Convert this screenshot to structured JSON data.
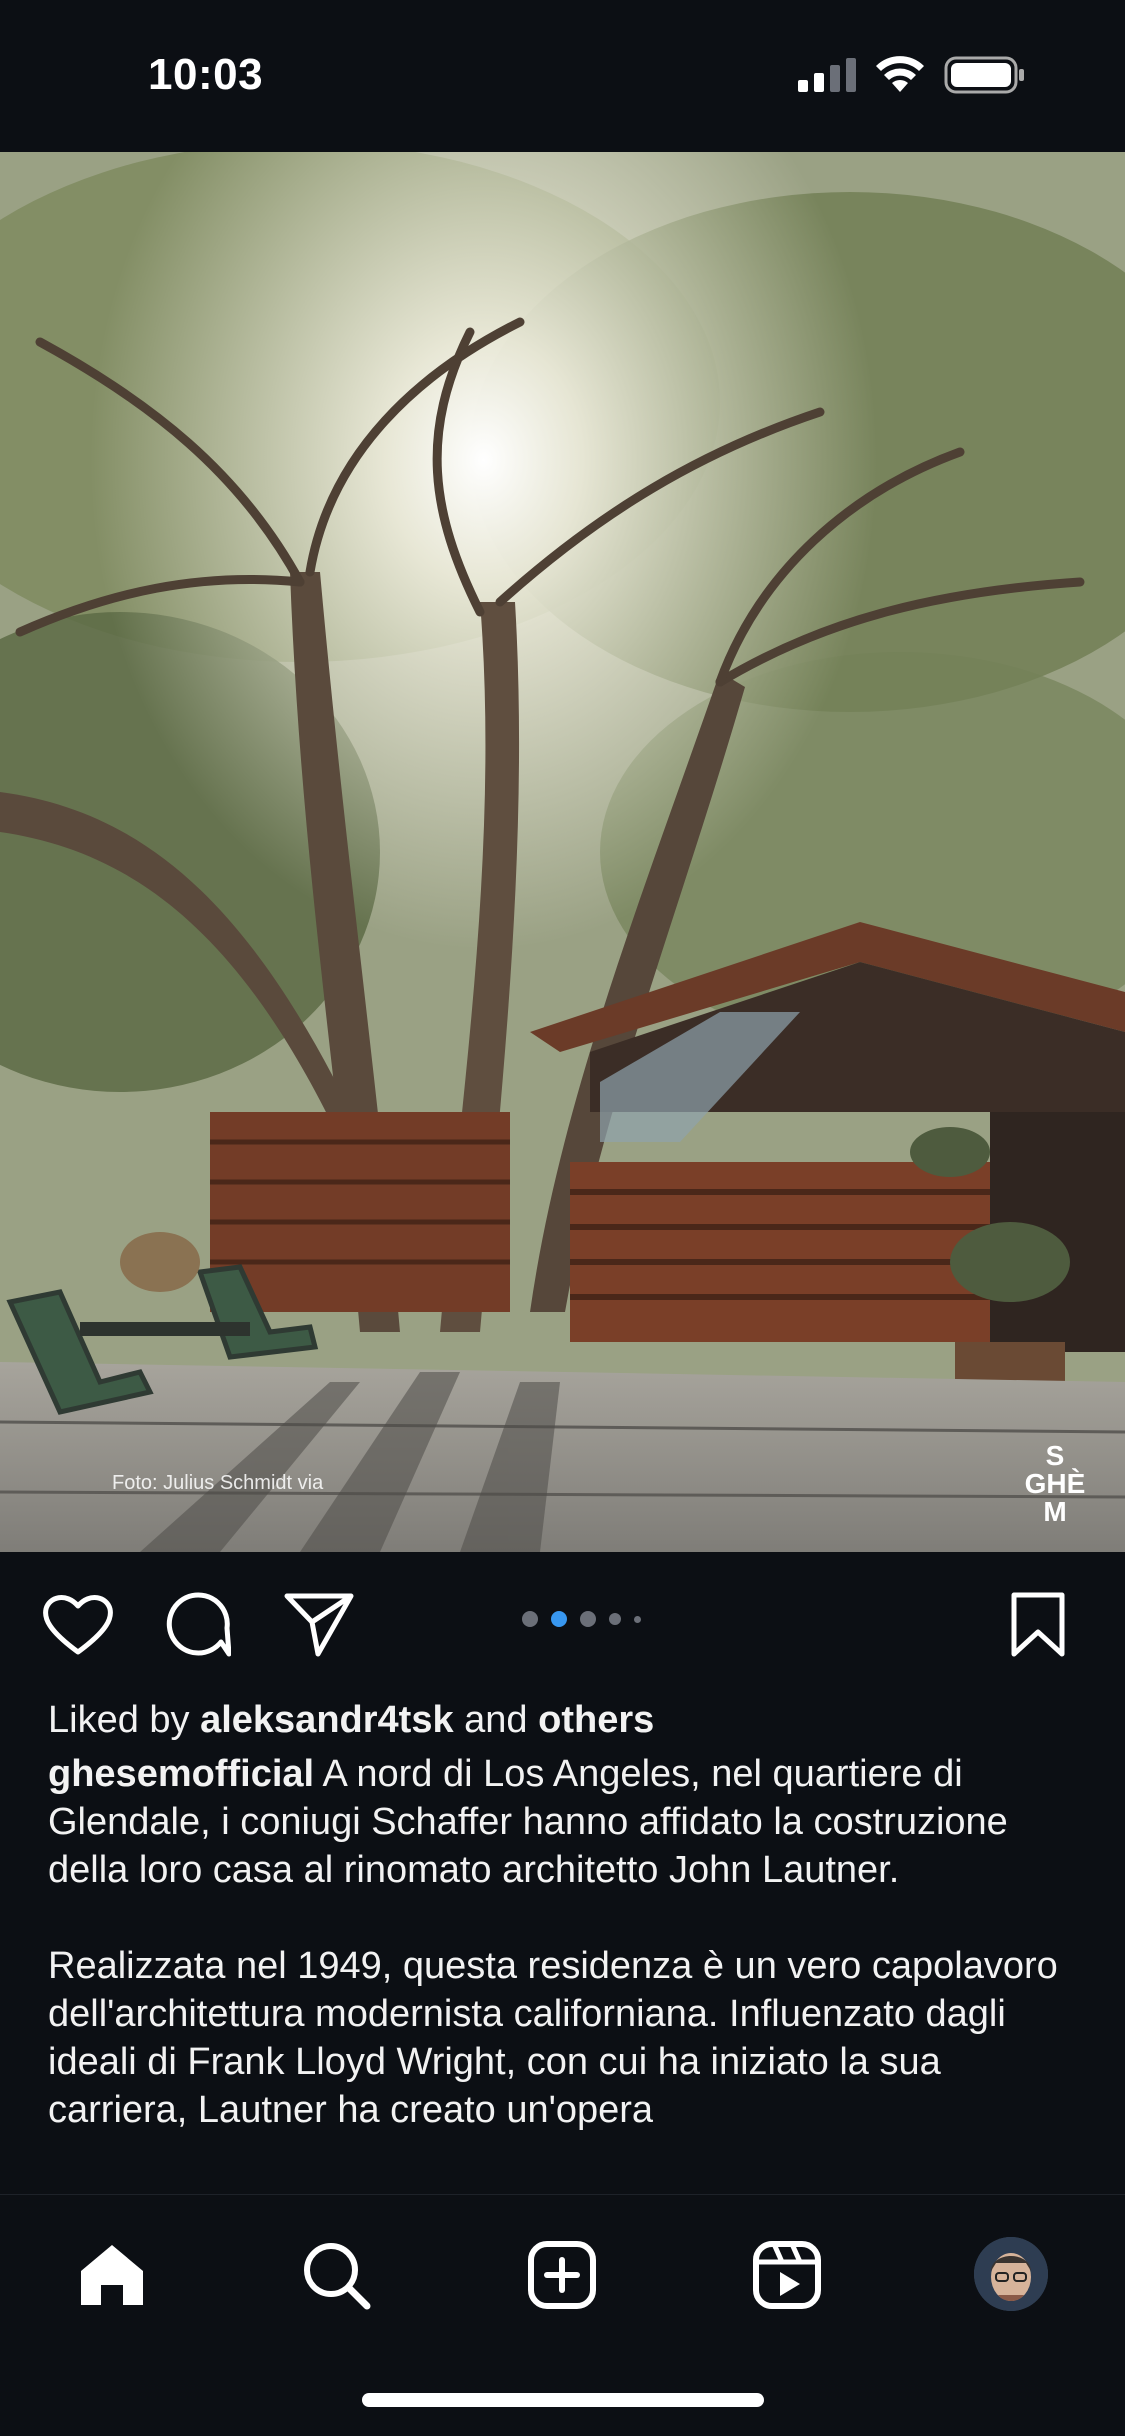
{
  "status_bar": {
    "time": "10:03",
    "icons": [
      "cellular-signal-icon",
      "wifi-icon",
      "battery-icon"
    ]
  },
  "post": {
    "photo": {
      "description": "Garden terrace with large oak trees and a modernist wooden house",
      "photo_credit": "Foto: Julius Schmidt via",
      "brand_mark": [
        "S",
        "GHÈ",
        "M"
      ]
    },
    "carousel": {
      "count": 5,
      "active_index": 1
    },
    "actions": {
      "like_icon": "heart-icon",
      "comment_icon": "comment-icon",
      "share_icon": "send-icon",
      "save_icon": "bookmark-icon"
    },
    "likes": {
      "prefix": "Liked by ",
      "user": "aleksandr4tsk",
      "connector": " and ",
      "others": "others"
    },
    "caption": {
      "username": "ghesemofficial",
      "text": " A nord di Los Angeles, nel quartiere di Glendale, i coniugi Schaffer hanno affidato la costruzione della loro casa al rinomato architetto John Lautner.",
      "paragraph2": "Realizzata nel 1949, questa residenza è un vero capolavoro dell'architettura modernista californiana. Influenzato dagli ideali di Frank Lloyd Wright, con cui ha iniziato la sua carriera, Lautner ha creato un'opera"
    }
  },
  "tab_bar": {
    "tabs": [
      "home-icon",
      "search-icon",
      "create-icon",
      "reels-icon",
      "profile-avatar"
    ],
    "active": "home-icon"
  },
  "colors": {
    "background": "#0c0f14",
    "text": "#f2f2f2",
    "carousel_active": "#3897f0",
    "carousel_inactive": "#6b6f78"
  }
}
